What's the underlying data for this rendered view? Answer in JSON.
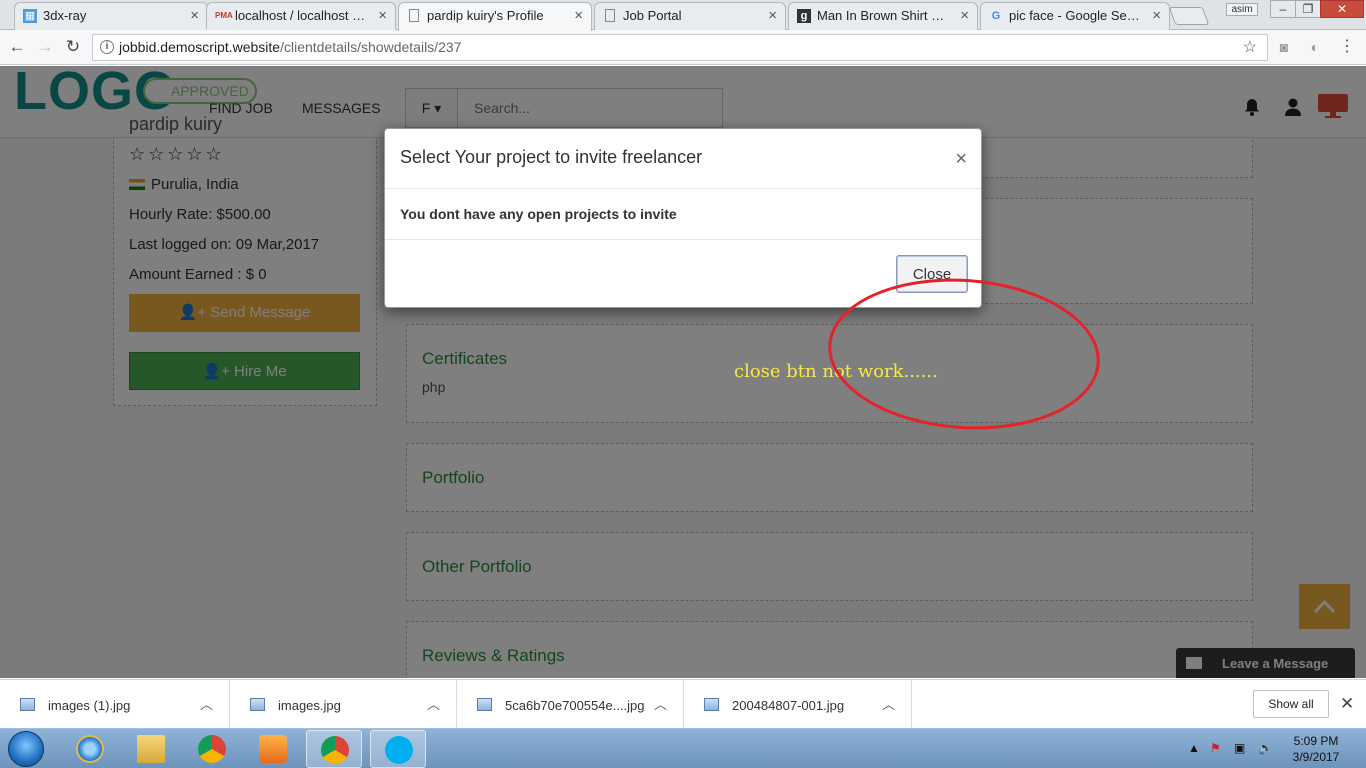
{
  "browser": {
    "tabs": [
      {
        "label": "3dx-ray",
        "icon": "building-icon",
        "active": false
      },
      {
        "label": "localhost / localhost / xra",
        "icon": "phpmyadmin-icon",
        "active": false
      },
      {
        "label": "pardip kuiry's Profile",
        "icon": "page-icon",
        "active": true
      },
      {
        "label": "Job Portal",
        "icon": "page-icon",
        "active": false
      },
      {
        "label": "Man In Brown Shirt Smili",
        "icon": "g-icon",
        "active": false
      },
      {
        "label": "pic face - Google Search",
        "icon": "google-icon",
        "active": false
      }
    ],
    "user_label": "asim",
    "url_host": "jobbid.demoscript.website",
    "url_path": "/clientdetails/showdetails/237"
  },
  "site": {
    "logo": "LOGO",
    "nav": {
      "find_job": "FIND JOB",
      "messages": "MESSAGES"
    },
    "search": {
      "filter": "F ▾",
      "placeholder": "Search..."
    }
  },
  "profile": {
    "badge": "APPROVED",
    "name": "pardip kuiry",
    "stars": "☆☆☆☆☆",
    "location": "Purulia, India",
    "hourly_rate": "Hourly Rate: $500.00",
    "last_logged": "Last logged on: 09 Mar,2017",
    "amount_earned": "Amount Earned : $ 0",
    "send_message": "Send Message",
    "hire_me": "Hire Me"
  },
  "sections": {
    "certificates": {
      "title": "Certificates",
      "text": "php"
    },
    "portfolio": {
      "title": "Portfolio"
    },
    "other_portfolio": {
      "title": "Other Portfolio"
    },
    "reviews": {
      "title": "Reviews & Ratings"
    }
  },
  "annotation": "close btn not work......",
  "modal": {
    "title": "Select Your project to invite freelancer",
    "x": "×",
    "body": "You dont have any open projects to invite",
    "close": "Close"
  },
  "chat": {
    "label": "Leave a Message"
  },
  "downloads": {
    "items": [
      "images (1).jpg",
      "images.jpg",
      "5ca6b70e700554e....jpg",
      "200484807-001.jpg"
    ],
    "show_all": "Show all"
  },
  "taskbar": {
    "time": "5:09 PM",
    "date": "3/9/2017"
  },
  "colors": {
    "accent_teal": "#138f8f",
    "orange": "#f0b03c",
    "green": "#4caf50",
    "annotation_red": "#e52129",
    "annotation_yellow": "#f5e94a"
  }
}
